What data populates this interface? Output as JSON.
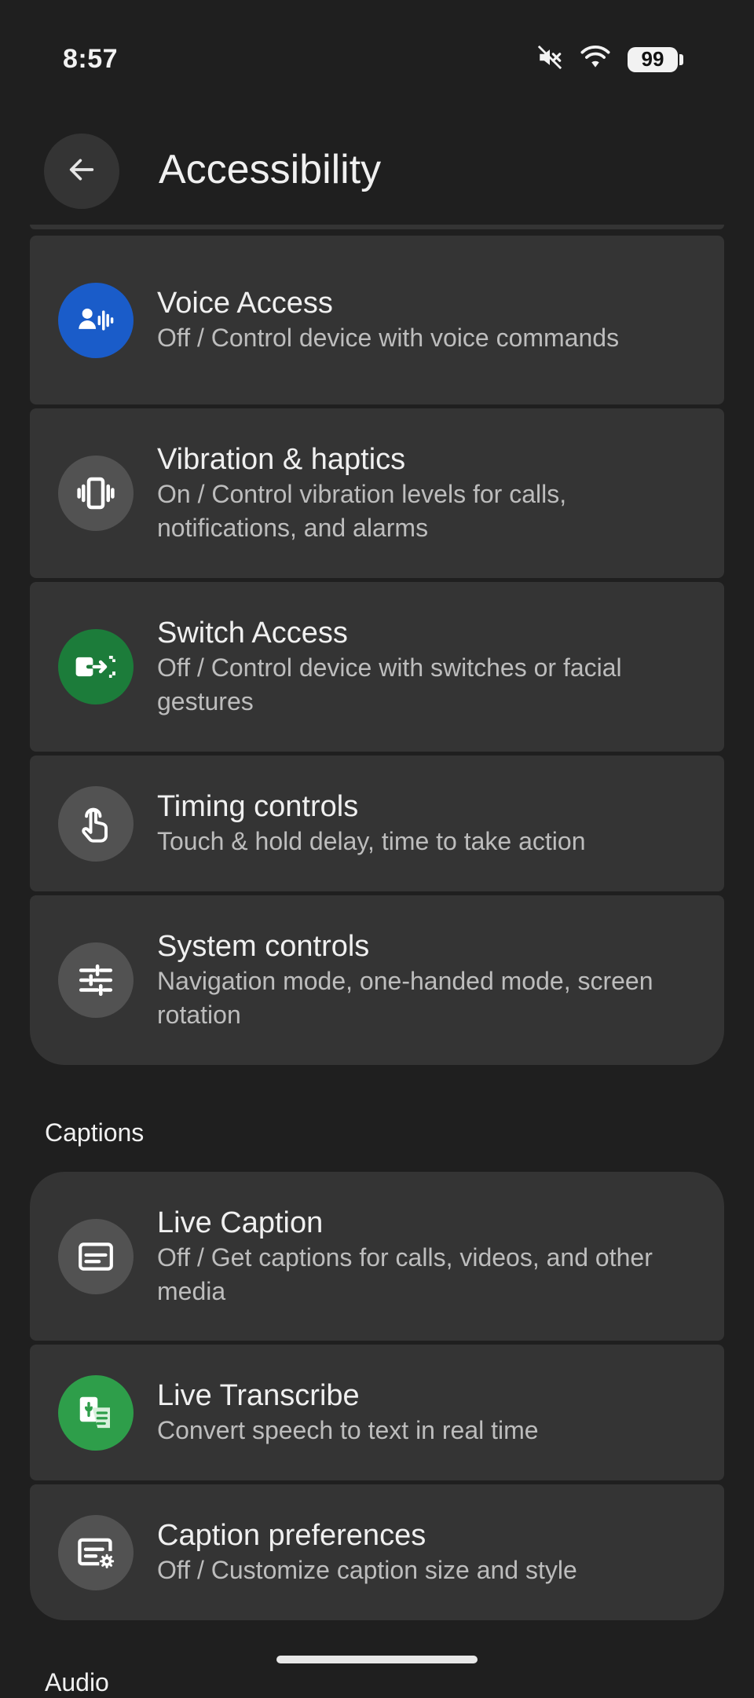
{
  "status_bar": {
    "time": "8:57",
    "battery": "99",
    "icons": [
      "mute-icon",
      "wifi-icon",
      "battery-icon"
    ]
  },
  "header": {
    "title": "Accessibility",
    "back_icon": "arrow-back-icon"
  },
  "interaction_items": [
    {
      "title": "Voice Access",
      "subtitle": "Off / Control device with voice commands",
      "icon": "voice-access-icon",
      "icon_bg": "#1a5cc9"
    },
    {
      "title": "Vibration & haptics",
      "subtitle": "On / Control vibration levels for calls, notifications, and alarms",
      "icon": "vibration-icon",
      "icon_bg": "#525252"
    },
    {
      "title": "Switch Access",
      "subtitle": "Off / Control device with switches or facial gestures",
      "icon": "switch-access-icon",
      "icon_bg": "#1c7c3a"
    },
    {
      "title": "Timing controls",
      "subtitle": "Touch & hold delay, time to take action",
      "icon": "touch-icon",
      "icon_bg": "#525252"
    },
    {
      "title": "System controls",
      "subtitle": "Navigation mode, one-handed mode, screen rotation",
      "icon": "sliders-icon",
      "icon_bg": "#525252"
    }
  ],
  "captions_section": {
    "title": "Captions",
    "items": [
      {
        "title": "Live Caption",
        "subtitle": "Off / Get captions for calls, videos, and other media",
        "icon": "live-caption-icon",
        "icon_bg": "#525252"
      },
      {
        "title": "Live Transcribe",
        "subtitle": "Convert speech to text in real time",
        "icon": "live-transcribe-icon",
        "icon_bg": "#2e9e4a"
      },
      {
        "title": "Caption preferences",
        "subtitle": "Off / Customize caption size and style",
        "icon": "caption-settings-icon",
        "icon_bg": "#525252"
      }
    ]
  },
  "next_section_partial": "Audio"
}
